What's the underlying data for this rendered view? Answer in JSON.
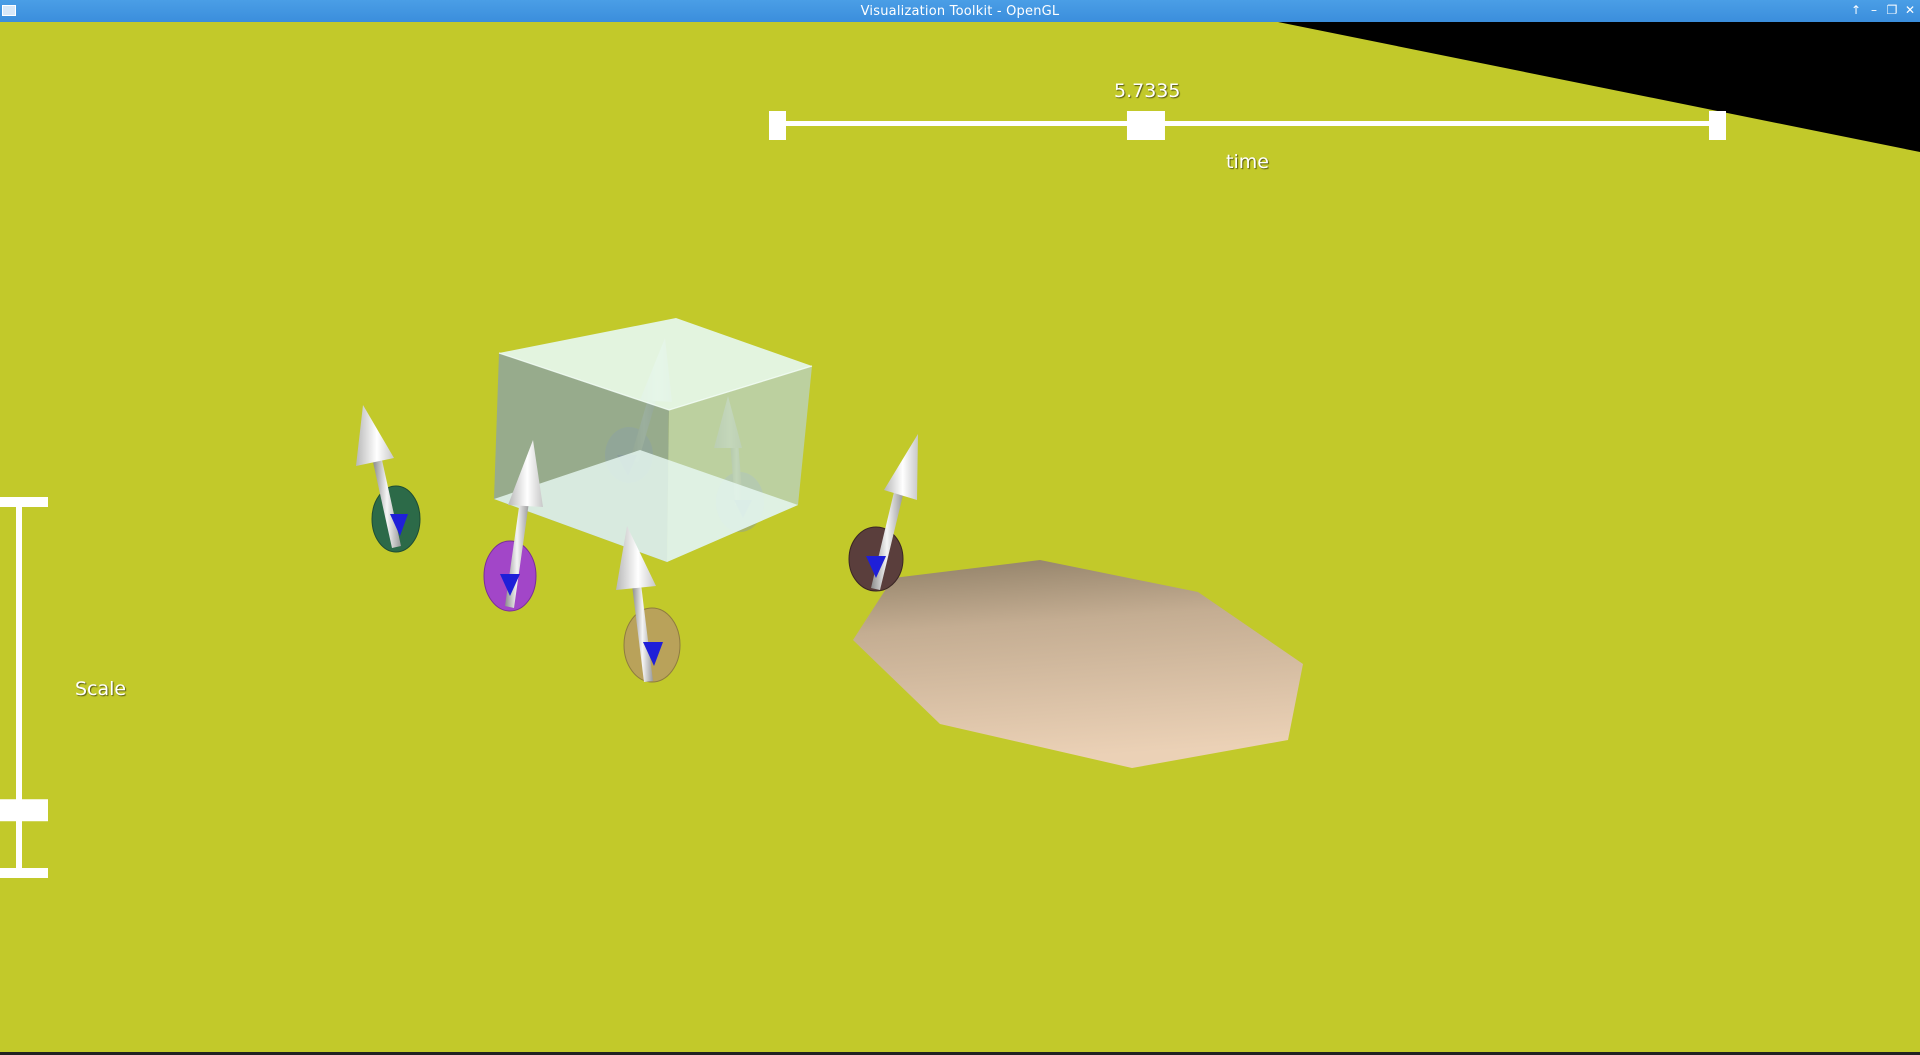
{
  "window": {
    "title": "Visualization Toolkit - OpenGL",
    "controls": {
      "raise_icon": "up-arrow-icon",
      "minimize_icon": "minimize-icon",
      "maximize_icon": "restore-icon",
      "close_icon": "close-icon"
    }
  },
  "scene": {
    "background_color": "#c2c92a",
    "corner_color": "#000000",
    "octagon_color": "#e8cfb4",
    "cube_color": "#dff4ee",
    "arrow_color": "#f2f2f2",
    "cone_color": "#1f1fd8",
    "disk_colors": [
      "#2c6a48",
      "#a246c8",
      "#b9a25a",
      "#5a3e3c",
      "#7f8fb4",
      "#8a9aa8"
    ]
  },
  "time_slider": {
    "title": "time",
    "value_label": "5.7335",
    "value_fraction": 0.39
  },
  "scale_slider": {
    "title": "Scale",
    "value_fraction": 0.16
  }
}
